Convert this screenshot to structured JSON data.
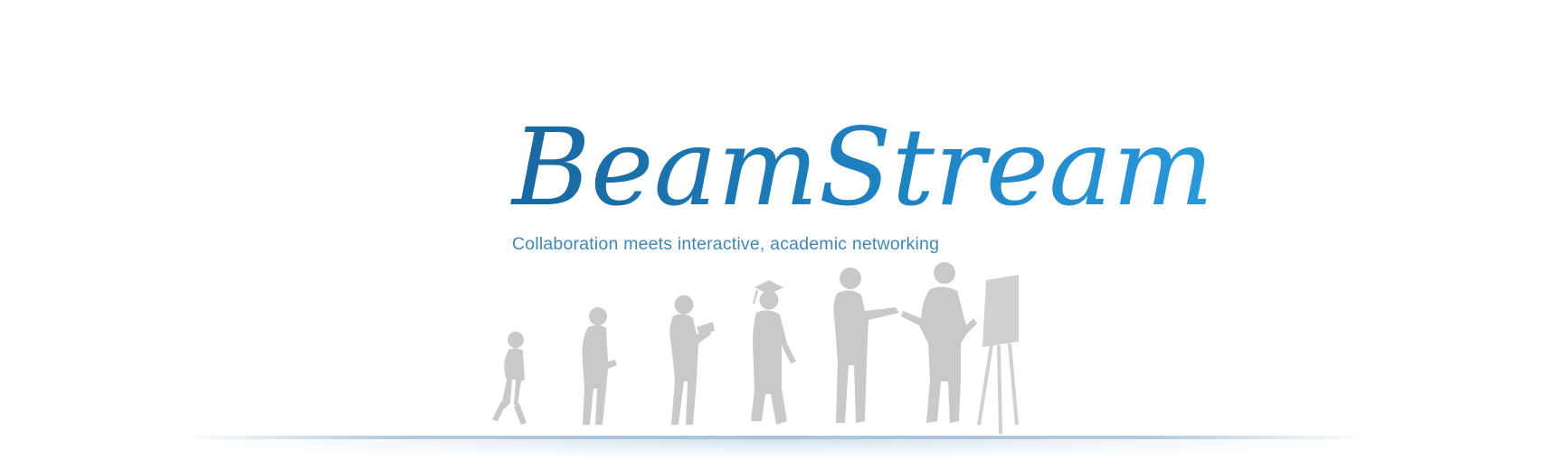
{
  "brand": {
    "name_part1": "Beam",
    "name_part2": "Stream",
    "tagline": "Collaboration meets interactive, academic networking"
  },
  "colors": {
    "logo_dark_blue": "#1c6da3",
    "logo_light_blue": "#2394d6",
    "tagline_blue": "#3f86b9",
    "silhouette_gray": "#c8c8c8",
    "ground_line": "#a9c2d8",
    "background": "#ffffff"
  },
  "illustration": {
    "figures": [
      "child-walking",
      "boy-with-phone",
      "teen-reading",
      "graduate",
      "man-pointing",
      "presenter-at-flipchart"
    ]
  }
}
